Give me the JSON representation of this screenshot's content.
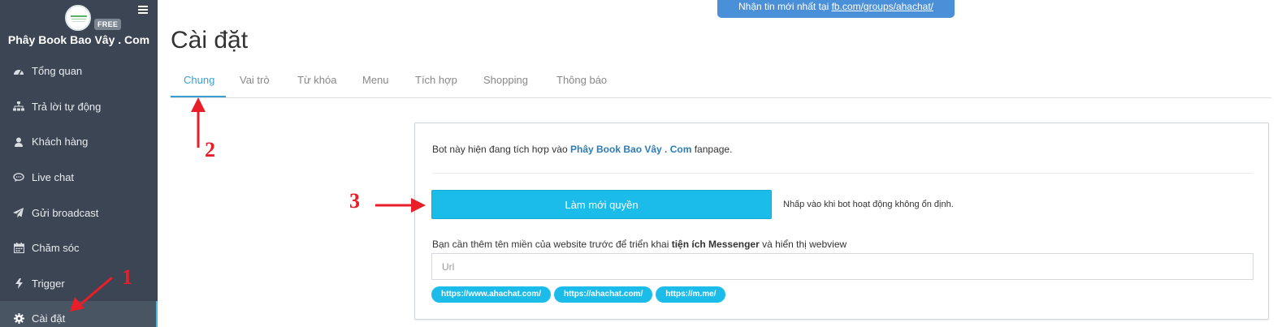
{
  "sidebar": {
    "badge": "FREE",
    "brand": "Phây Book Bao Vây . Com",
    "items": [
      {
        "label": "Tổng quan",
        "icon": "dashboard-icon"
      },
      {
        "label": "Trả lời tự động",
        "icon": "sitemap-icon"
      },
      {
        "label": "Khách hàng",
        "icon": "user-icon"
      },
      {
        "label": "Live chat",
        "icon": "chat-bubble-icon"
      },
      {
        "label": "Gửi broadcast",
        "icon": "paper-plane-icon"
      },
      {
        "label": "Chăm sóc",
        "icon": "calendar-icon"
      },
      {
        "label": "Trigger",
        "icon": "bolt-icon"
      },
      {
        "label": "Cài đặt",
        "icon": "gear-icon"
      }
    ]
  },
  "banner": {
    "prefix": "Nhận tin mới nhất tại ",
    "link": "fb.com/groups/ahachat/"
  },
  "page": {
    "title": "Cài đặt"
  },
  "tabs": [
    "Chung",
    "Vai trò",
    "Từ khóa",
    "Menu",
    "Tích hợp",
    "Shopping",
    "Thông báo"
  ],
  "panel": {
    "desc_prefix": "Bot này hiện đang tích hợp vào ",
    "desc_page": "Phây Book Bao Vây . Com",
    "desc_suffix": " fanpage.",
    "refresh_button": "Làm mới quyền",
    "hint": "Nhấp vào khi bot hoạt động không ổn định.",
    "domain_prefix": "Bạn cần thêm tên miền của website trước để triển khai ",
    "domain_bold": "tiện ích Messenger",
    "domain_suffix": " và hiển thị webview",
    "url_placeholder": "Url",
    "chips": [
      "https://www.ahachat.com/",
      "https://ahachat.com/",
      "https://m.me/"
    ]
  },
  "annotations": [
    "1",
    "2",
    "3"
  ],
  "colors": {
    "sidebar_bg": "#3b4553",
    "accent": "#1bbcea",
    "tab_active": "#3c9fd4",
    "banner_bg": "#4a90d9",
    "annotation": "#e81e28"
  }
}
